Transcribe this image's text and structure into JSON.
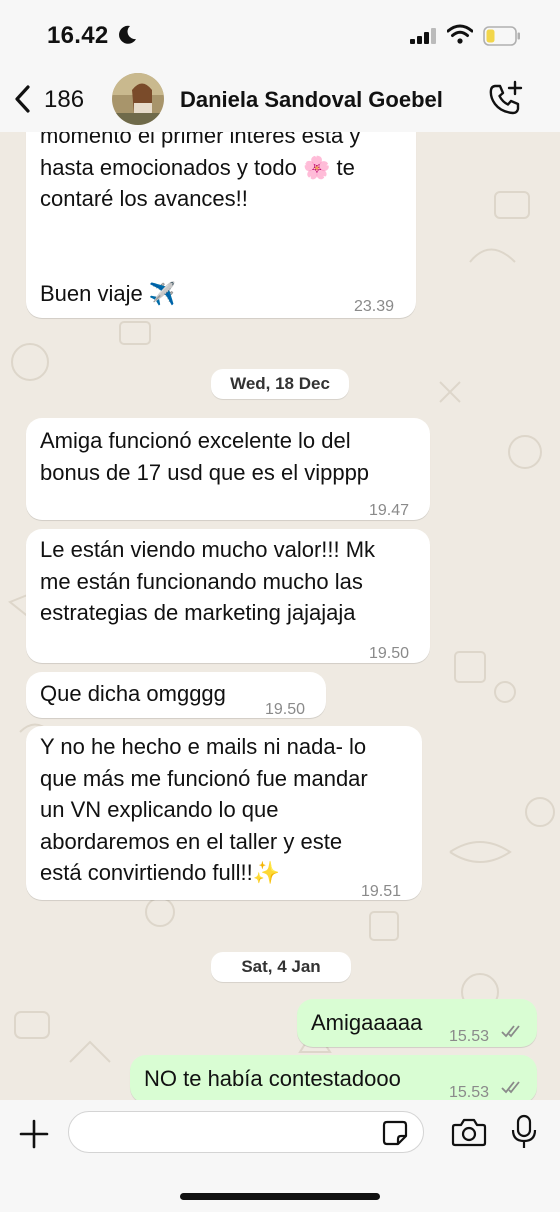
{
  "status_bar": {
    "time": "16.42",
    "icons": [
      "moon-icon",
      "signal-icon",
      "wifi-icon",
      "battery-icon"
    ]
  },
  "header": {
    "back_count": "186",
    "contact_name": "Daniela Sandoval Goebel",
    "icons": [
      "back-icon",
      "avatar",
      "call-add-icon"
    ]
  },
  "messages": [
    {
      "type": "incoming",
      "text": "momento el primer interes esta y\nhasta emocionados y todo 🌸 te\ncontaré los avances!!\n\n\nBuen viaje ✈️",
      "time": "23.39"
    },
    {
      "type": "date",
      "label": "Wed, 18 Dec"
    },
    {
      "type": "incoming",
      "text": "Amiga funcionó excelente lo del\nbonus de 17 usd que es el vipppp",
      "time": "19.47"
    },
    {
      "type": "incoming",
      "text": "Le están viendo mucho valor!!! Mk\nme están funcionando mucho las\nestrategias de marketing jajajaja",
      "time": "19.50"
    },
    {
      "type": "incoming",
      "text": "Que dicha omgggg",
      "time": "19.50"
    },
    {
      "type": "incoming",
      "text": "Y no he hecho e mails ni nada- lo\nque más me funcionó fue mandar\nun VN explicando lo que\nabordaremos en el taller y este\nestá convirtiendo full!!✨",
      "time": "19.51"
    },
    {
      "type": "date",
      "label": "Sat, 4 Jan"
    },
    {
      "type": "outgoing",
      "text": "Amigaaaaa",
      "time": "15.53",
      "status": "read"
    },
    {
      "type": "outgoing",
      "text": "NO te había contestadooo",
      "time": "15.53",
      "status": "read"
    }
  ],
  "input_bar": {
    "placeholder": "",
    "value": "",
    "icons": [
      "plus-icon",
      "sticker-icon",
      "camera-icon",
      "mic-icon"
    ]
  },
  "colors": {
    "chat_bg": "#efeae2",
    "incoming_bubble": "#ffffff",
    "outgoing_bubble": "#d9fdd3",
    "read_ticks": "#8a8a8a"
  }
}
